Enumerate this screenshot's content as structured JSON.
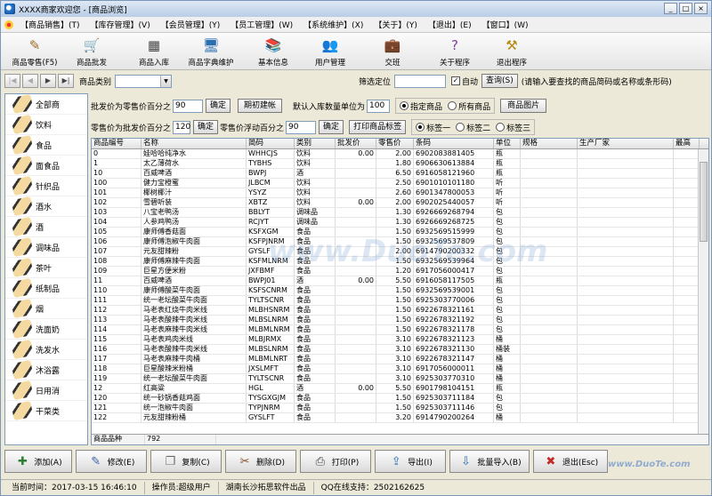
{
  "window": {
    "title": "XXXX商家欢迎您 - [商品浏览]"
  },
  "menu": [
    "【商品销售】(T)",
    "【库存管理】(V)",
    "【会员管理】(Y)",
    "【员工管理】(W)",
    "【系统维护】(X)",
    "【关于】(Y)",
    "【退出】(E)",
    "【窗口】(W)"
  ],
  "toolbar": [
    {
      "label": "商品零售(F5)",
      "icon": "ticket-icon"
    },
    {
      "label": "商品批发",
      "icon": "cart-icon"
    },
    {
      "label": "商品入库",
      "icon": "calculator-icon"
    },
    {
      "label": "商品字典维护",
      "icon": "computer-icon"
    },
    {
      "label": "基本信息",
      "icon": "books-icon"
    },
    {
      "label": "用户管理",
      "icon": "users-icon"
    },
    {
      "label": "交班",
      "icon": "briefcase-icon"
    },
    {
      "label": "关于程序",
      "icon": "help-icon"
    },
    {
      "label": "退出程序",
      "icon": "exit-icon"
    }
  ],
  "search": {
    "category_label": "商品类别",
    "filter_label": "筛选定位",
    "auto_label": "自动",
    "query_button": "查询(S)",
    "hint": "(请输入要查找的商品简码或名称或条形码)"
  },
  "categories": [
    "全部商",
    "饮料",
    "食品",
    "面食品",
    "针织品",
    "酒水",
    "酒",
    "调味品",
    "茶叶",
    "纸制品",
    "烟",
    "洗面奶",
    "洗发水",
    "沐浴露",
    "日用消",
    "干菜类"
  ],
  "settings": {
    "wholesale_label": "批发价为零售价百分之",
    "wholesale_value": "90",
    "confirm": "确定",
    "init_button": "期初建帐",
    "default_qty_label": "默认入库数量单位为",
    "default_qty_value": "100",
    "radio_specified": "指定商品",
    "radio_all": "所有商品",
    "image_button": "商品图片",
    "retail_label": "零售价为批发价百分之",
    "retail_value": "120",
    "float_label": "零售价浮动百分之",
    "float_value": "90",
    "print_label_button": "打印商品标签",
    "label_one": "标签一",
    "label_two": "标签二",
    "label_three": "标签三"
  },
  "table": {
    "columns": [
      "商品编号",
      "名称",
      "简码",
      "类别",
      "批发价",
      "零售价",
      "条码",
      "单位",
      "规格",
      "生产厂家",
      "最高"
    ],
    "rows": [
      [
        "0",
        "娃哈哈纯净水",
        "WHHCJS",
        "饮料",
        "0.00",
        "2.00",
        "6902083881405",
        "瓶"
      ],
      [
        "1",
        "太乙薄荷水",
        "TYBHS",
        "饮料",
        "",
        "1.80",
        "6906630613884",
        "瓶"
      ],
      [
        "10",
        "百威啤酒",
        "BWPJ",
        "酒",
        "",
        "6.50",
        "6916058121960",
        "瓶"
      ],
      [
        "100",
        "健力宝橙蜜",
        "JLBCM",
        "饮料",
        "",
        "2.50",
        "6901010101180",
        "听"
      ],
      [
        "101",
        "椰树椰汁",
        "YSYZ",
        "饮料",
        "",
        "2.60",
        "6901347800053",
        "听"
      ],
      [
        "102",
        "雪碧听装",
        "XBTZ",
        "饮料",
        "0.00",
        "2.00",
        "6902025440057",
        "听"
      ],
      [
        "103",
        "八宝老鸭汤",
        "BBLYT",
        "调味品",
        "",
        "1.30",
        "6926669268794",
        "包"
      ],
      [
        "104",
        "人参鸡鸭汤",
        "RCJYT",
        "调味品",
        "",
        "1.30",
        "6926669268725",
        "包"
      ],
      [
        "105",
        "康师傅香菇面",
        "KSFXGM",
        "食品",
        "",
        "1.50",
        "6932569515999",
        "包"
      ],
      [
        "106",
        "康师傅泡椒牛肉面",
        "KSFPJNRM",
        "食品",
        "",
        "1.50",
        "6932569537809",
        "包"
      ],
      [
        "107",
        "元友甜辣粉",
        "GYSLF",
        "食品",
        "",
        "2.00",
        "6914790200332",
        "包"
      ],
      [
        "108",
        "康师傅麻辣牛肉面",
        "KSFMLNRM",
        "食品",
        "",
        "1.50",
        "6932569539964",
        "包"
      ],
      [
        "109",
        "巨星方便米粉",
        "JXFBMF",
        "食品",
        "",
        "1.20",
        "6917056000417",
        "包"
      ],
      [
        "11",
        "百威啤酒",
        "BWPJ01",
        "酒",
        "0.00",
        "5.50",
        "6916058117505",
        "瓶"
      ],
      [
        "110",
        "康师傅酸菜牛肉面",
        "KSFSCNRM",
        "食品",
        "",
        "1.50",
        "6932569539001",
        "包"
      ],
      [
        "111",
        "统一老坛酸菜牛肉面",
        "TYLTSCNR",
        "食品",
        "",
        "1.50",
        "6925303770006",
        "包"
      ],
      [
        "112",
        "马老表红烧牛肉米线",
        "MLBHSNRM",
        "食品",
        "",
        "1.50",
        "6922678321161",
        "包"
      ],
      [
        "113",
        "马老表酸辣牛肉米线",
        "MLBSLNRM",
        "食品",
        "",
        "1.50",
        "6922678321192",
        "包"
      ],
      [
        "114",
        "马老表麻辣牛肉米线",
        "MLBMLNRM",
        "食品",
        "",
        "1.50",
        "6922678321178",
        "包"
      ],
      [
        "115",
        "马老表鸡肉米线",
        "MLBJRMX",
        "食品",
        "",
        "3.10",
        "6922678321123",
        "桶"
      ],
      [
        "116",
        "马老表酸辣牛肉米线",
        "MLBSLNRM",
        "食品",
        "",
        "3.10",
        "6922678321130",
        "桶装"
      ],
      [
        "117",
        "马老表麻辣牛肉桶",
        "MLBMLNRT",
        "食品",
        "",
        "3.10",
        "6922678321147",
        "桶"
      ],
      [
        "118",
        "巨星酸辣米粉桶",
        "JXSLMFT",
        "食品",
        "",
        "3.10",
        "6917056000011",
        "桶"
      ],
      [
        "119",
        "统一老坛酸菜牛肉面",
        "TYLTSCNR",
        "食品",
        "",
        "3.10",
        "6925303770310",
        "桶"
      ],
      [
        "12",
        "红高粱",
        "HGL",
        "酒",
        "0.00",
        "5.50",
        "6901798104151",
        "瓶"
      ],
      [
        "120",
        "统一砂锅香菇鸡面",
        "TYSGXGJM",
        "食品",
        "",
        "1.50",
        "6925303711184",
        "包"
      ],
      [
        "121",
        "统一泡椒牛肉面",
        "TYPJNRM",
        "食品",
        "",
        "1.50",
        "6925303711146",
        "包"
      ],
      [
        "122",
        "元友甜辣粉桶",
        "GYSLFT",
        "食品",
        "",
        "3.20",
        "6914790200264",
        "桶"
      ]
    ],
    "footer_label": "商品品种",
    "footer_value": "792"
  },
  "bottom_buttons": [
    {
      "label": "添加(A)",
      "icon": "add-icon"
    },
    {
      "label": "修改(E)",
      "icon": "edit-icon"
    },
    {
      "label": "复制(C)",
      "icon": "copy-icon"
    },
    {
      "label": "删除(D)",
      "icon": "delete-icon"
    },
    {
      "label": "打印(P)",
      "icon": "print-icon"
    },
    {
      "label": "导出(I)",
      "icon": "export-icon"
    },
    {
      "label": "批量导入(B)",
      "icon": "import-icon"
    },
    {
      "label": "退出(Esc)",
      "icon": "close-icon"
    }
  ],
  "status": {
    "time": "当前时间：2017-03-15 16:46:10",
    "operator": "操作员:超级用户",
    "company": "湖南长沙拓思软件出品",
    "qq": "QQ在线支持：2502162625"
  },
  "watermark": "www.DuoTe.com",
  "watermark2": "www.DuoTe.com"
}
